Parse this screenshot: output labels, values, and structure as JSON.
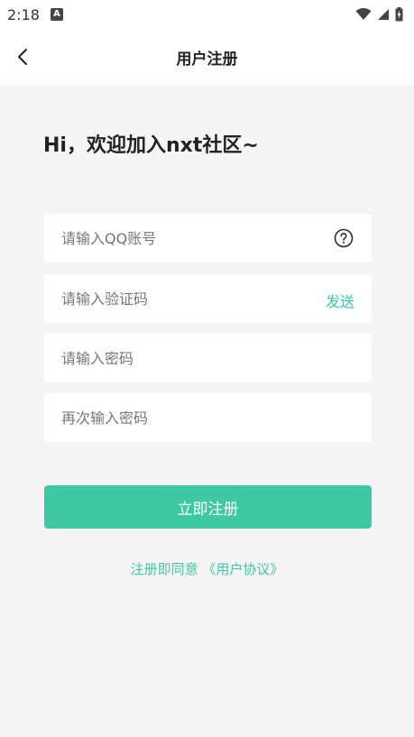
{
  "status_bar": {
    "time": "2:18",
    "badge": "A",
    "icons": [
      "wifi-icon",
      "signal-icon",
      "battery-charging-icon"
    ]
  },
  "header": {
    "title": "用户注册",
    "back_icon": "chevron-left-icon"
  },
  "welcome_text": "Hi，欢迎加入nxt社区~",
  "form": {
    "qq_account_placeholder": "请输入QQ账号",
    "qq_help_icon": "question-circle-icon",
    "verification_code_placeholder": "请输入验证码",
    "send_label": "发送",
    "password_placeholder": "请输入密码",
    "confirm_password_placeholder": "再次输入密码"
  },
  "register_button_label": "立即注册",
  "agreement": {
    "prefix": "注册即同意 ",
    "link": "《用户协议》"
  },
  "colors": {
    "accent": "#3ec9a3",
    "background": "#f5f5f5",
    "surface": "#ffffff"
  }
}
